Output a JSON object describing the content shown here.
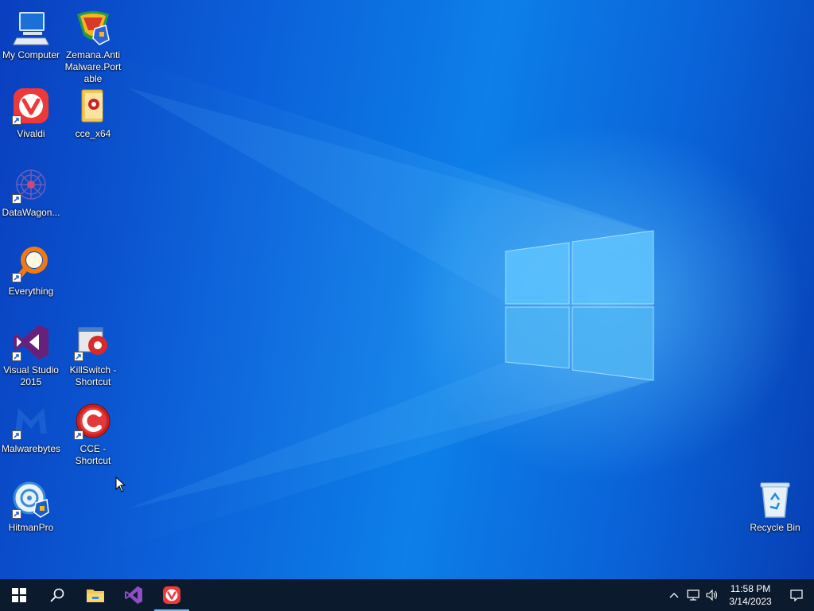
{
  "desktop": {
    "icons": [
      {
        "label": "My Computer",
        "icon": "computer-icon"
      },
      {
        "label": "Zemana.AntiMalware.Portable",
        "icon": "zemana-icon"
      },
      {
        "label": "Vivaldi",
        "icon": "vivaldi-icon"
      },
      {
        "label": "cce_x64",
        "icon": "folder-icon"
      },
      {
        "label": "DataWagon...",
        "icon": "datawagon-icon"
      },
      {
        "label": "Everything",
        "icon": "everything-icon"
      },
      {
        "label": "Visual Studio 2015",
        "icon": "visual-studio-icon"
      },
      {
        "label": "KillSwitch - Shortcut",
        "icon": "killswitch-icon"
      },
      {
        "label": "Malwarebytes",
        "icon": "malwarebytes-icon"
      },
      {
        "label": "CCE - Shortcut",
        "icon": "cce-icon"
      },
      {
        "label": "HitmanPro",
        "icon": "hitmanpro-icon"
      },
      {
        "label": "Recycle Bin",
        "icon": "recycle-bin-icon"
      }
    ]
  },
  "taskbar": {
    "buttons": [
      "start-icon",
      "search-icon",
      "file-explorer-icon",
      "visual-studio-icon",
      "vivaldi-icon"
    ],
    "clock": {
      "time": "11:58 PM",
      "date": "3/14/2023"
    },
    "tray": [
      "chevron-up-icon",
      "network-icon",
      "volume-icon",
      "notification-icon"
    ]
  },
  "colors": {
    "accent": "#0a63d8",
    "taskbar": "#0c1a2e"
  }
}
